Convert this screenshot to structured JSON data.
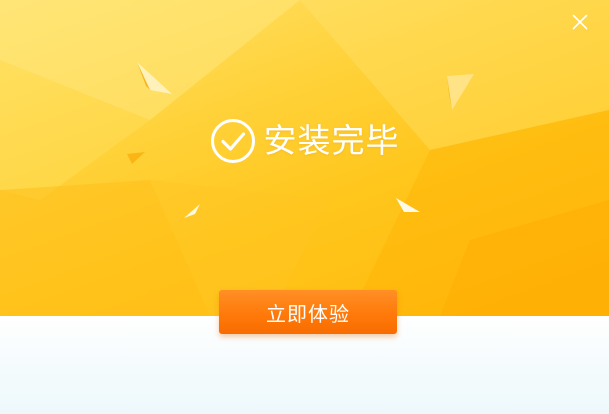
{
  "window": {
    "close_icon": "close-icon"
  },
  "status": {
    "icon": "check-circle-icon",
    "text": "安装完毕"
  },
  "action": {
    "button_label": "立即体验"
  },
  "colors": {
    "hero_top": "#ffe36f",
    "hero_bottom": "#ffb80a",
    "button": "#ff7a0a",
    "text": "#ffffff",
    "footer": "#f4fbfd"
  }
}
